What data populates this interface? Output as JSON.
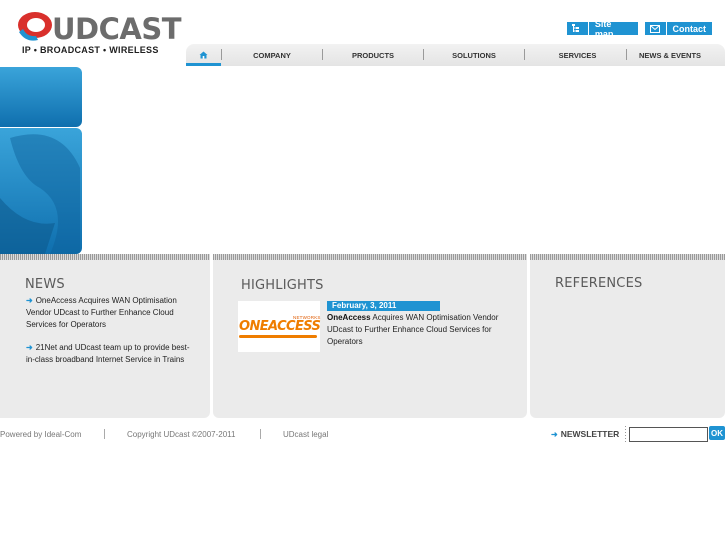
{
  "brand": {
    "name": "UDCAST",
    "tagline": "IP • BROADCAST • WIRELESS",
    "accent_color": "#1f93d2",
    "logo_red": "#d9302c"
  },
  "toplinks": {
    "sitemap": {
      "label": "Site map",
      "icon": "sitemap-icon"
    },
    "contact": {
      "label": "Contact",
      "icon": "envelope-icon"
    }
  },
  "nav": {
    "home_icon": "home-icon",
    "items": [
      {
        "label": "COMPANY"
      },
      {
        "label": "PRODUCTS"
      },
      {
        "label": "SOLUTIONS"
      },
      {
        "label": "SERVICES"
      },
      {
        "label": "NEWS & EVENTS"
      }
    ]
  },
  "news": {
    "title": "NEWS",
    "items": [
      {
        "text": "OneAccess Acquires WAN Optimisation Vendor UDcast to Further Enhance Cloud Services for Operators"
      },
      {
        "text": "21Net and UDcast team up to provide best-in-class broadband Internet Service in Trains"
      }
    ]
  },
  "highlights": {
    "title": "HIGHLIGHTS",
    "logo_text": "ONEACCESS",
    "logo_subtext": "NETWORKS",
    "date": "February, 3, 2011",
    "company": "OneAccess",
    "text": " Acquires WAN Optimisation Vendor UDcast to Further Enhance Cloud Services for Operators"
  },
  "references": {
    "title": "REFERENCES"
  },
  "footer": {
    "powered": "Powered by Ideal-Com",
    "copyright": "Copyright UDcast ©2007-2011",
    "legal": "UDcast legal",
    "newsletter_label": "NEWSLETTER",
    "newsletter_value": "",
    "ok_label": "OK"
  }
}
